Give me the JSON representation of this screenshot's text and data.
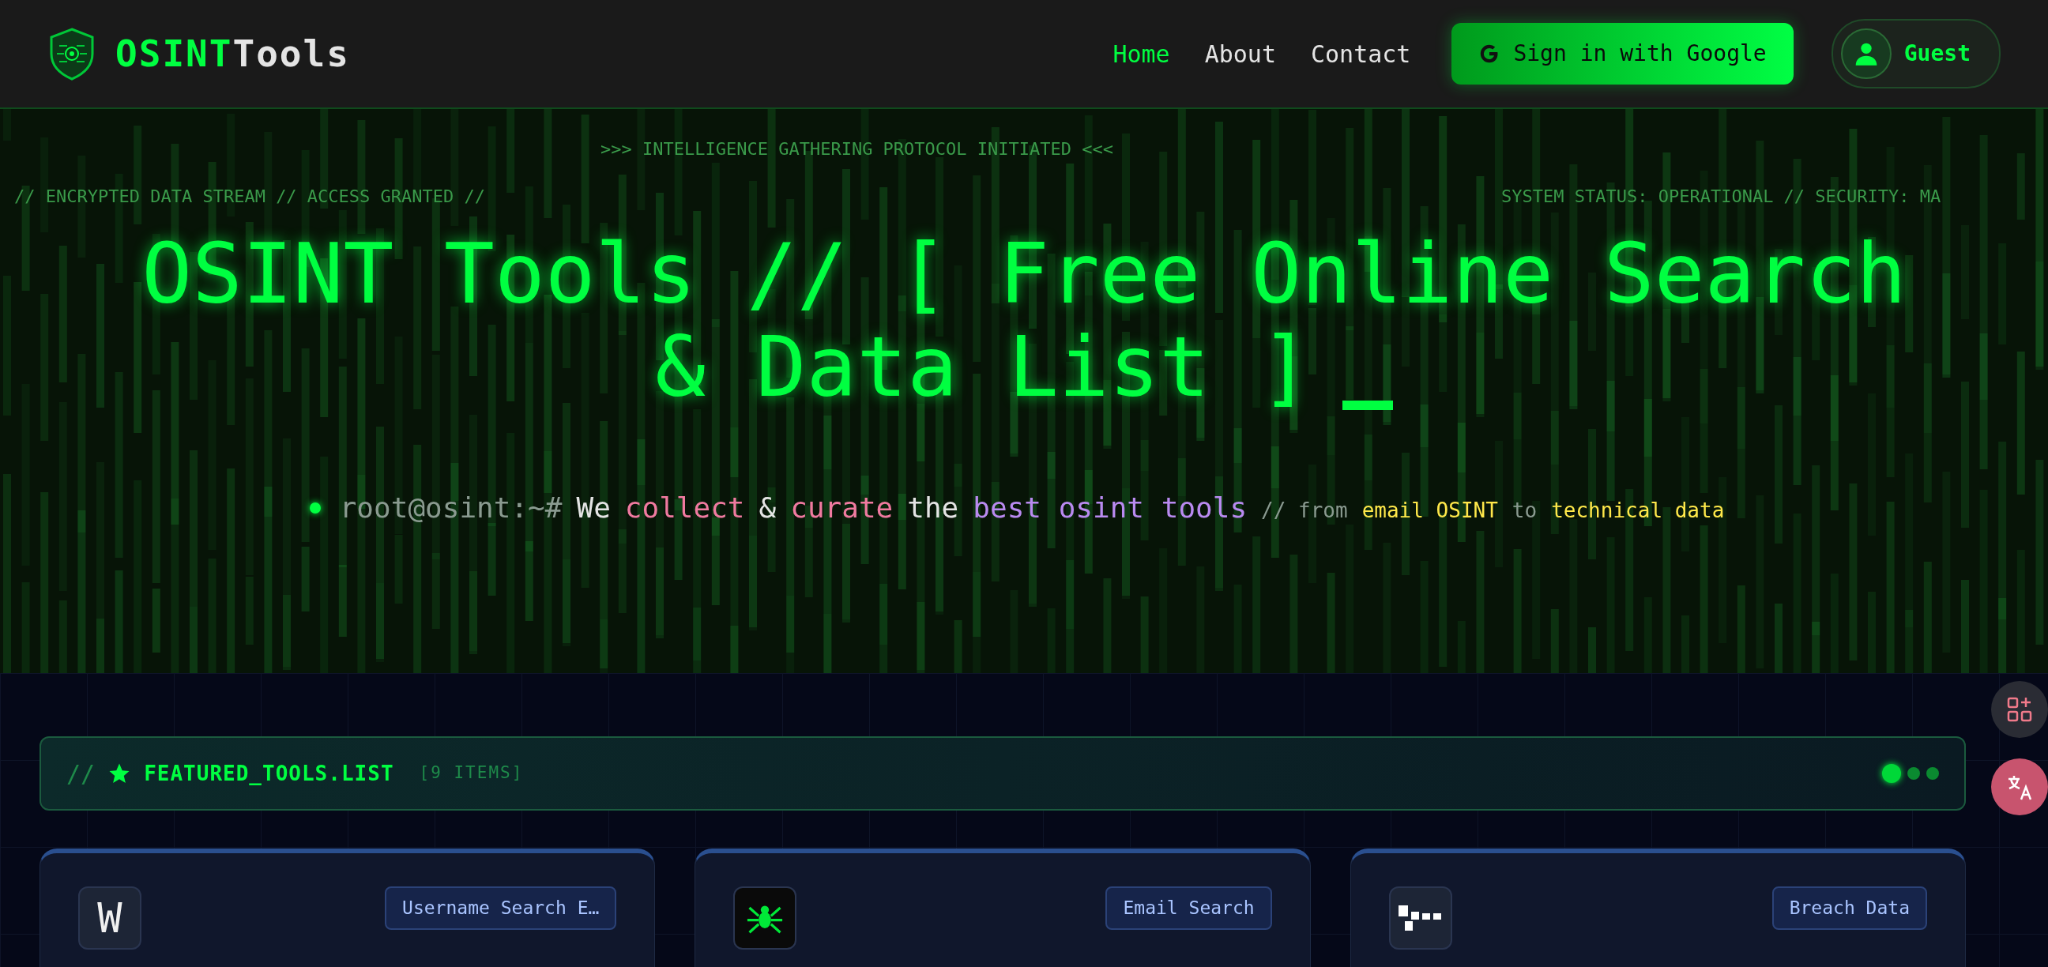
{
  "navbar": {
    "brand": {
      "accent": "OSINT",
      "rest": "Tools"
    },
    "links": [
      {
        "label": "Home",
        "selected": true
      },
      {
        "label": "About",
        "selected": false
      },
      {
        "label": "Contact",
        "selected": false
      }
    ],
    "sign_in": "Sign in with Google",
    "user": "Guest"
  },
  "hero": {
    "overlays": [
      ">>> INTELLIGENCE GATHERING PROTOCOL INITIATED <<<",
      "// ENCRYPTED DATA STREAM // ACCESS GRANTED //",
      "SYSTEM STATUS: OPERATIONAL // SECURITY: MA"
    ],
    "title_lines": [
      "OSINT Tools // [ Free Online Search",
      "& Data List ]"
    ],
    "subtitle": [
      {
        "kind": "prompt",
        "text": "root@osint:~#"
      },
      {
        "kind": "plain",
        "text": "We"
      },
      {
        "kind": "pink",
        "text": "collect"
      },
      {
        "kind": "plain",
        "text": "&"
      },
      {
        "kind": "pink",
        "text": "curate"
      },
      {
        "kind": "plain",
        "text": "the"
      },
      {
        "kind": "purple",
        "text": "best osint tools"
      },
      {
        "kind": "comment",
        "text": "// from"
      },
      {
        "kind": "yellow",
        "text": "email OSINT"
      },
      {
        "kind": "comment",
        "text": "to"
      },
      {
        "kind": "yellow",
        "text": "technical data"
      }
    ]
  },
  "featured": {
    "prefix": "//",
    "title": "FEATURED_TOOLS.LIST",
    "count": "[9 ITEMS]",
    "cards": [
      {
        "kind": "letter",
        "letter": "W",
        "tag": "Username Search E…"
      },
      {
        "kind": "spider",
        "tag": "Email Search"
      },
      {
        "kind": "blocks",
        "tag": "Breach Data"
      }
    ]
  }
}
